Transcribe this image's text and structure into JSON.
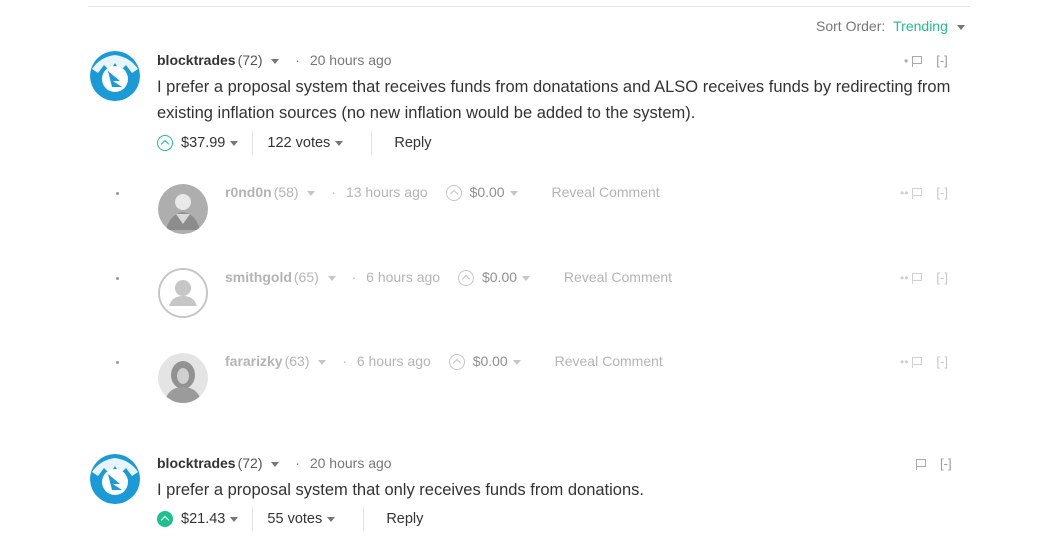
{
  "sort": {
    "label": "Sort Order:",
    "value": "Trending"
  },
  "comments": [
    {
      "author": "blocktrades",
      "rep": "(72)",
      "time": "20 hours ago",
      "body": "I prefer a proposal system that receives funds from donatations and ALSO receives funds by redirecting from existing inflation sources (no new inflation would be added to the system).",
      "payout": "$37.99",
      "votes": "122 votes",
      "reply": "Reply",
      "collapse": "[-]",
      "replies": [
        {
          "author": "r0nd0n",
          "rep": "(58)",
          "time": "13 hours ago",
          "payout": "$0.00",
          "reveal": "Reveal Comment",
          "collapse": "[-]"
        },
        {
          "author": "smithgold",
          "rep": "(65)",
          "time": "6 hours ago",
          "payout": "$0.00",
          "reveal": "Reveal Comment",
          "collapse": "[-]"
        },
        {
          "author": "fararizky",
          "rep": "(63)",
          "time": "6 hours ago",
          "payout": "$0.00",
          "reveal": "Reveal Comment",
          "collapse": "[-]"
        }
      ]
    },
    {
      "author": "blocktrades",
      "rep": "(72)",
      "time": "20 hours ago",
      "body": "I prefer a proposal system that only receives funds from donations.",
      "payout": "$21.43",
      "votes": "55 votes",
      "reply": "Reply",
      "collapse": "[-]"
    }
  ],
  "colors": {
    "accent": "#1fbf8f",
    "brand": "#1a9bd7"
  }
}
